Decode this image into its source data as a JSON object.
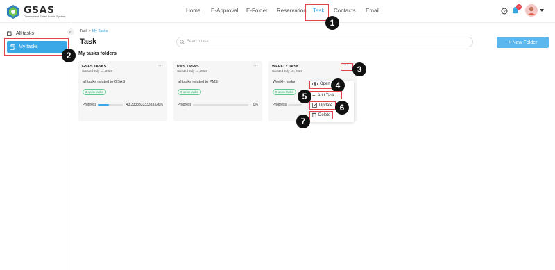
{
  "brand": {
    "name": "GSAS",
    "subtitle": "Government Smart Admin System"
  },
  "nav": [
    {
      "label": "Home"
    },
    {
      "label": "E-Approval"
    },
    {
      "label": "E-Folder"
    },
    {
      "label": "Reservation"
    },
    {
      "label": "Task"
    },
    {
      "label": "Contacts"
    },
    {
      "label": "Email"
    }
  ],
  "notifications": {
    "count": "13"
  },
  "sidebar": {
    "items": [
      {
        "label": "All tasks"
      },
      {
        "label": "My tasks"
      }
    ]
  },
  "breadcrumb": {
    "root": "Task",
    "sep": ">",
    "current": "My Tasks"
  },
  "page": {
    "title": "Task",
    "section": "My tasks folders",
    "new_folder": "+ New Folder"
  },
  "search": {
    "placeholder": "Search task"
  },
  "cards": [
    {
      "title": "GSAS TASKS",
      "created": "Created July 14, 2023",
      "desc": "all tasks related to GSAS",
      "badge": "3 open tasks",
      "progress_label": "Progress",
      "progress_text": "43.333333333333336%",
      "progress": 0.433
    },
    {
      "title": "PMS TASKS",
      "created": "Created July 14, 2023",
      "desc": "all tasks related to PMS",
      "badge": "0 open tasks",
      "progress_label": "Progress",
      "progress_text": "0%",
      "progress": 0
    },
    {
      "title": "WEEKLY TASK",
      "created": "Created July 19, 2023",
      "desc": "Weekly tasks",
      "badge": "0 open tasks",
      "progress_label": "Progress",
      "progress_text": "",
      "progress": 0
    }
  ],
  "menu": {
    "open": "Open",
    "add": "Add Task",
    "update": "Update",
    "delete": "Delete"
  },
  "callouts": [
    "1",
    "2",
    "3",
    "4",
    "5",
    "6",
    "7"
  ],
  "colors": {
    "accent": "#3aa8e6",
    "highlight": "#e2444d"
  }
}
